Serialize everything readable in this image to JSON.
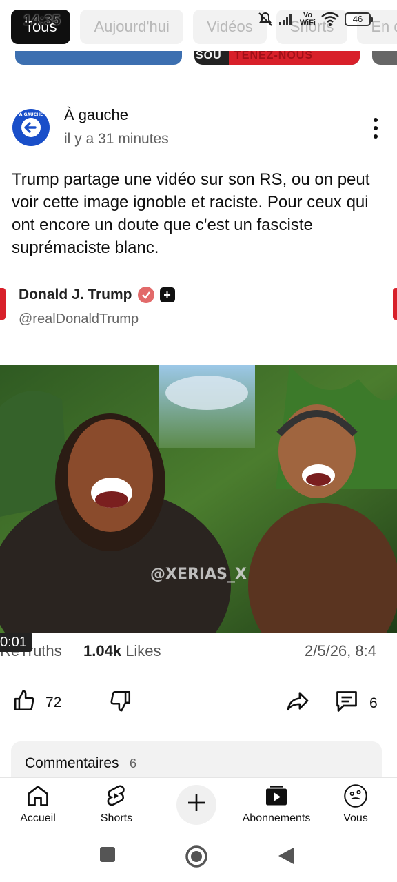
{
  "status_bar": {
    "time": "14:35",
    "network_label_top": "Vo",
    "network_label_bottom": "WiFi",
    "battery": "46"
  },
  "filter_chips": [
    {
      "label": "Tous",
      "active": true
    },
    {
      "label": "Aujourd'hui",
      "active": false
    },
    {
      "label": "Vidéos",
      "active": false
    },
    {
      "label": "Shorts",
      "active": false
    },
    {
      "label": "En direct",
      "active": false
    }
  ],
  "top_thumb_text": {
    "left": "SOU",
    "right": "TENEZ-NOUS"
  },
  "post": {
    "channel_name": "À gauche",
    "channel_avatar_text": "À GAUCHE",
    "time_ago": "il y a 31 minutes",
    "text": "Trump partage une vidéo sur son RS, ou on peut voir cette image ignoble et raciste. Pour ceux qui ont encore un doute que c'est un fasciste suprémaciste blanc.",
    "embed": {
      "author_name": "Donald J. Trump",
      "handle": "@realDonaldTrump",
      "watermark": "@XERIAS_X",
      "duration": "0:01",
      "retruths_label": "ReTruths",
      "likes_count": "1.04k",
      "likes_label": "Likes",
      "date": "2/5/26, 8:4"
    },
    "likes": "72",
    "comments": "6"
  },
  "comments_section": {
    "title": "Commentaires",
    "count": "6"
  },
  "bottom_nav": {
    "home": "Accueil",
    "shorts": "Shorts",
    "subscriptions": "Abonnements",
    "you": "Vous"
  },
  "colors": {
    "chip_active_bg": "#0f0f0f",
    "chip_bg": "#f2f2f2",
    "channel_blue": "#1a4fc9",
    "accent_red": "#d8202a",
    "text_secondary": "#606060"
  }
}
